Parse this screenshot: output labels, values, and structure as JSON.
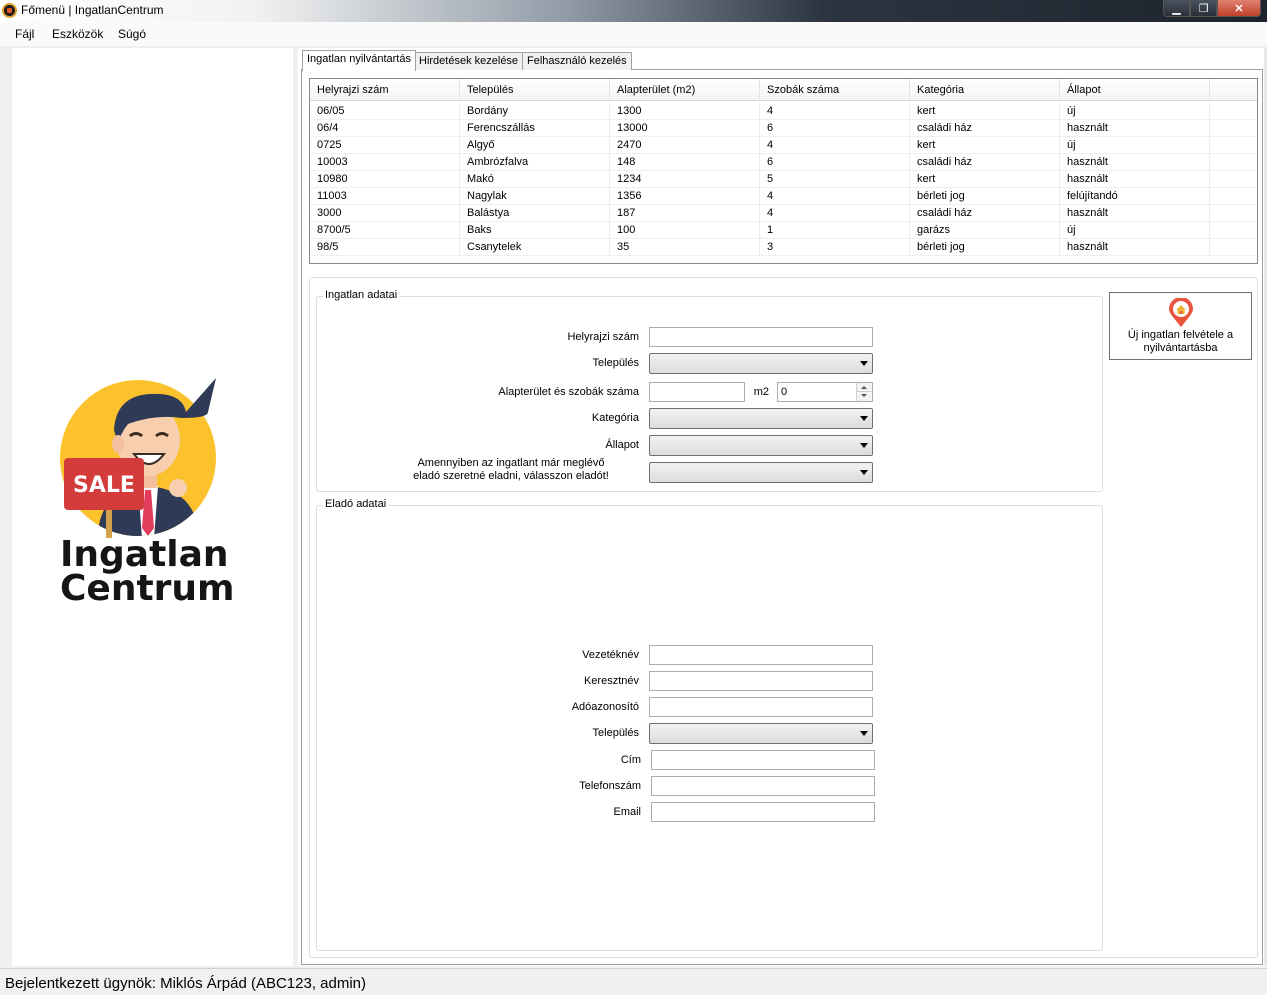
{
  "window": {
    "title": "Főmenü | IngatlanCentrum",
    "min_symbol": "▁",
    "max_symbol": "❐",
    "close_symbol": "✕"
  },
  "menu": [
    {
      "label": "Fájl"
    },
    {
      "label": "Eszközök"
    },
    {
      "label": "Súgó"
    }
  ],
  "logo": {
    "badge_text": "SALE",
    "line1": "Ingatlan",
    "line2": "Centrum"
  },
  "tabs": [
    {
      "label": "Ingatlan nyilvántartás",
      "active": true
    },
    {
      "label": "Hirdetések kezelése",
      "active": false
    },
    {
      "label": "Felhasználó kezelés",
      "active": false
    }
  ],
  "table": {
    "columns": [
      "Helyrajzi szám",
      "Település",
      "Alapterület (m2)",
      "Szobák száma",
      "Kategória",
      "Állapot"
    ],
    "rows": [
      [
        "06/05",
        "Bordány",
        "1300",
        "4",
        "kert",
        "új"
      ],
      [
        "06/4",
        "Ferencszállás",
        "13000",
        "6",
        "családi ház",
        "használt"
      ],
      [
        "0725",
        "Algyő",
        "2470",
        "4",
        "kert",
        "új"
      ],
      [
        "10003",
        "Ambrózfalva",
        "148",
        "6",
        "családi ház",
        "használt"
      ],
      [
        "10980",
        "Makó",
        "1234",
        "5",
        "kert",
        "használt"
      ],
      [
        "11003",
        "Nagylak",
        "1356",
        "4",
        "bérleti jog",
        "felújítandó"
      ],
      [
        "3000",
        "Balástya",
        "187",
        "4",
        "családi ház",
        "használt"
      ],
      [
        "8700/5",
        "Baks",
        "100",
        "1",
        "garázs",
        "új"
      ],
      [
        "98/5",
        "Csanytelek",
        "35",
        "3",
        "bérleti jog",
        "használt"
      ]
    ]
  },
  "property_group": {
    "title": "Ingatlan adatai",
    "lbl_parcel": "Helyrajzi szám",
    "lbl_settlement": "Település",
    "lbl_area_rooms": "Alapterület és szobák száma",
    "unit_m2": "m2",
    "rooms_value": "0",
    "lbl_category": "Kategória",
    "lbl_condition": "Állapot",
    "lbl_seller_line1": "Amennyiben az ingatlant már meglévő",
    "lbl_seller_line2": "eladó szeretné eladni, válasszon eladót!"
  },
  "seller_group": {
    "title": "Eladó adatai",
    "lbl_lastname": "Vezetéknév",
    "lbl_firstname": "Keresztnév",
    "lbl_taxid": "Adóazonosító",
    "lbl_settlement": "Település",
    "lbl_address": "Cím",
    "lbl_phone": "Telefonszám",
    "lbl_email": "Email"
  },
  "add_button": {
    "line1": "Új ingatlan felvétele a",
    "line2": "nyilvántartásba"
  },
  "status": {
    "text": "Bejelentkezett ügynök: Miklós Árpád (ABC123, admin)"
  },
  "colors": {
    "pin_accent": "#e8553e",
    "logo_yellow": "#fcc22d",
    "sale_red": "#d43b3b"
  }
}
